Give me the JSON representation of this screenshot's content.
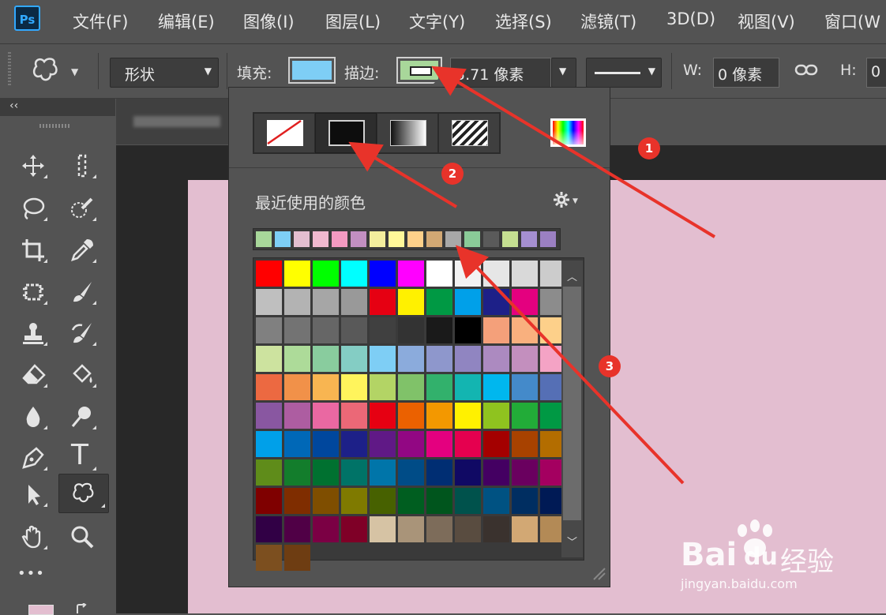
{
  "app": {
    "logo": "Ps"
  },
  "menu": [
    "文件(F)",
    "编辑(E)",
    "图像(I)",
    "图层(L)",
    "文字(Y)",
    "选择(S)",
    "滤镜(T)",
    "3D(D)",
    "视图(V)",
    "窗口(W"
  ],
  "options": {
    "tool_icon": "custom-shape-icon",
    "mode_value": "形状",
    "fill_label": "填充:",
    "fill_color": "#7ecef5",
    "stroke_label": "描边:",
    "stroke_color": "#a8d79a",
    "stroke_width": "5.71 像素",
    "w_label": "W:",
    "w_value": "0 像素",
    "link_icon": "link-icon",
    "h_label": "H:",
    "h_value": "0"
  },
  "document": {
    "tab_title": "..."
  },
  "toolbar": {
    "collapse_glyph": "‹‹",
    "more_glyph": "•••",
    "tools": [
      "move-icon",
      "marquee-icon",
      "lasso-icon",
      "quick-select-icon",
      "crop-icon",
      "eyedropper-icon",
      "frame-icon",
      "brush-icon",
      "stamp-icon",
      "history-brush-icon",
      "eraser-icon",
      "paint-bucket-icon",
      "blur-icon",
      "dodge-icon",
      "pen-icon",
      "type-icon",
      "path-select-icon",
      "custom-shape-icon",
      "hand-icon",
      "zoom-icon"
    ],
    "type_glyph": "T"
  },
  "popover": {
    "fill_types": [
      "none",
      "solid",
      "gradient",
      "pattern"
    ],
    "picker_icon": "color-picker-icon",
    "recent_label": "最近使用的颜色",
    "gear_icon": "gear-icon",
    "recent_colors": [
      "#a8d79a",
      "#7ecef5",
      "#e3bed0",
      "#f0b9cf",
      "#f49ac1",
      "#c28fc1",
      "#f3ee9d",
      "#fff799",
      "#fdd08a",
      "#d2a874",
      "#a8a8a8",
      "#8acb98",
      "#5a5a5a",
      "#c5df91",
      "#a58fd0",
      "#9b80c2"
    ],
    "swatches": [
      "#ff0000",
      "#ffff00",
      "#00ff00",
      "#00ffff",
      "#0000ff",
      "#ff00ff",
      "#ffffff",
      "#f2f2f2",
      "#e6e6e6",
      "#d9d9d9",
      "#cccccc",
      "#bfbfbf",
      "#b3b3b3",
      "#a6a6a6",
      "#999999",
      "#e60012",
      "#fff100",
      "#009944",
      "#00a0e9",
      "#1d2088",
      "#e4007f",
      "#8c8c8c",
      "#808080",
      "#737373",
      "#666666",
      "#595959",
      "#404040",
      "#333333",
      "#1a1a1a",
      "#000000",
      "#f4a07a",
      "#f9b07e",
      "#fdd08a",
      "#cde39f",
      "#addb99",
      "#89cc9e",
      "#84cdc4",
      "#7ecef5",
      "#8babdc",
      "#8e97cc",
      "#9085c1",
      "#ac8ac0",
      "#c38fbe",
      "#f4a3c5",
      "#ec6941",
      "#f19149",
      "#f8b551",
      "#fff45c",
      "#b3d465",
      "#80c269",
      "#32b16c",
      "#13b5b1",
      "#00b7ee",
      "#448aca",
      "#556fb5",
      "#8957a1",
      "#ad5da1",
      "#ea68a2",
      "#eb6877",
      "#e60012",
      "#eb6100",
      "#f39800",
      "#fff100",
      "#8fc31f",
      "#22ac38",
      "#009944",
      "#00a0e9",
      "#0068b7",
      "#00479d",
      "#1d2088",
      "#601986",
      "#920783",
      "#e4007f",
      "#e5004f",
      "#a40000",
      "#a84200",
      "#b36d00",
      "#5f8c1a",
      "#137d2c",
      "#007130",
      "#007367",
      "#0075a9",
      "#004c87",
      "#002e73",
      "#100964",
      "#440062",
      "#6a005f",
      "#a40060",
      "#7f0000",
      "#7f2d00",
      "#7f4e00",
      "#7f7a00",
      "#476100",
      "#005e20",
      "#00551d",
      "#00524c",
      "#005282",
      "#002e61",
      "#001a55",
      "#310045",
      "#500046",
      "#7b0044",
      "#7f0027",
      "#d6c3a4",
      "#a99479",
      "#7d6c5a",
      "#594c40",
      "#3a322e",
      "#d2a874",
      "#b38a56",
      "#7c4f1f",
      "#6e3d12"
    ]
  },
  "annotations": [
    "1",
    "2",
    "3"
  ],
  "watermark": {
    "brand": "Bai",
    "brand2": "du",
    "cn": "经验",
    "url": "jingyan.baidu.com"
  }
}
